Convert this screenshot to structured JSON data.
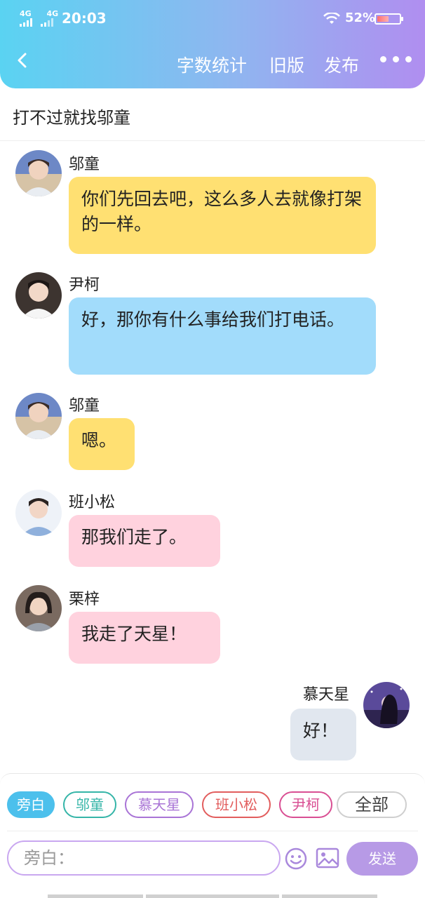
{
  "status_bar": {
    "network1": "4G",
    "network2": "4G",
    "time": "20:03",
    "battery": "52%",
    "battery_level": 0.52
  },
  "nav": {
    "back_icon": "chevron-left-icon",
    "word_count": "字数统计",
    "old_version": "旧版",
    "publish": "发布",
    "more_icon": "more-dots-icon"
  },
  "title": "打不过就找邬童",
  "messages": [
    {
      "name": "邬童",
      "text": "你们先回去吧，这么多人去就像打架的一样。",
      "color": "#ffe072",
      "side": "left"
    },
    {
      "name": "尹柯",
      "text": "好，那你有什么事给我们打电话。",
      "color": "#a2dcfb",
      "side": "left"
    },
    {
      "name": "邬童",
      "text": "嗯。",
      "color": "#ffe072",
      "side": "left"
    },
    {
      "name": "班小松",
      "text": "那我们走了。",
      "color": "#ffd2de",
      "side": "left"
    },
    {
      "name": "栗梓",
      "text": "我走了天星！",
      "color": "#ffd2de",
      "side": "left"
    },
    {
      "name": "慕天星",
      "text": "好！",
      "color": "#e1e7ef",
      "side": "right"
    }
  ],
  "role_chips": [
    {
      "label": "旁白",
      "color": "#4cc0ec",
      "selected": true
    },
    {
      "label": "邬童",
      "color": "#35b5a8",
      "selected": false
    },
    {
      "label": "慕天星",
      "color": "#a974d6",
      "selected": false
    },
    {
      "label": "班小松",
      "color": "#e25d5d",
      "selected": false
    },
    {
      "label": "尹柯",
      "color": "#d94f93",
      "selected": false
    },
    {
      "label": "全部",
      "color": "#999999",
      "selected": false
    }
  ],
  "input": {
    "placeholder": "旁白："
  },
  "icons": {
    "emoji": "emoji-icon",
    "image": "image-icon"
  },
  "send_label": "发送"
}
